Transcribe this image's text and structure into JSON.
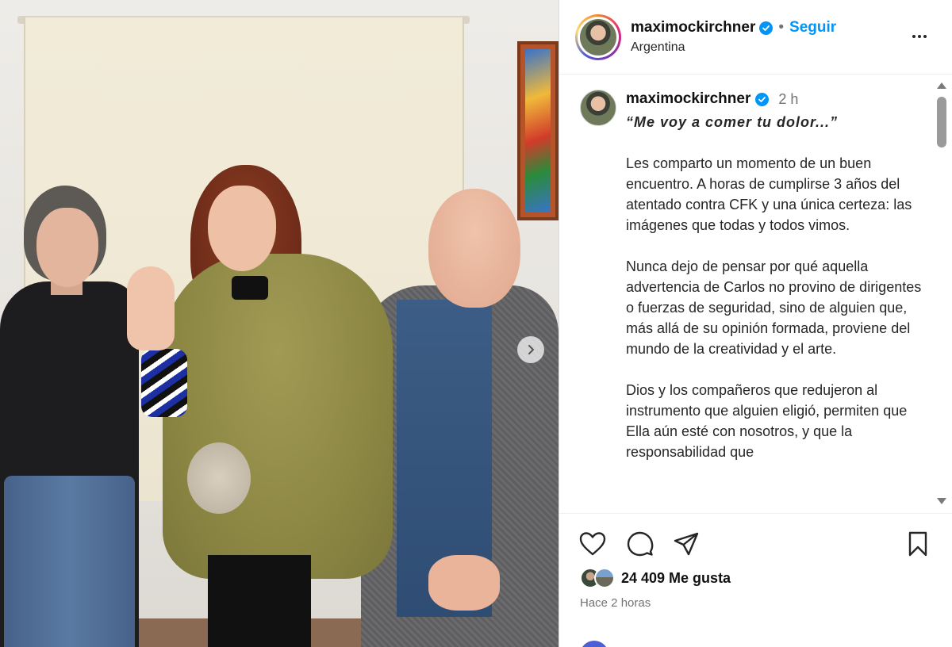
{
  "post": {
    "username": "maximockirchner",
    "follow_label": "Seguir",
    "separator": "•",
    "location": "Argentina",
    "options_icon": "more-horizontal-icon"
  },
  "caption": {
    "username": "maximockirchner",
    "time": "2 h",
    "quote": "“Me voy a comer tu dolor...”",
    "paragraphs": [
      "Les comparto un momento de un buen encuentro. A horas de cumplirse 3 años del atentado contra CFK y una única certeza: las imágenes que todas y todos vimos.",
      "Nunca dejo de pensar por qué aquella advertencia de Carlos no provino de dirigentes o fuerzas de seguridad, sino de alguien que, más allá de su opinión formada, proviene del mundo de la creatividad y el arte.",
      "Dios y los compañeros que redujeron al instrumento que alguien eligió, permiten que Ella aún esté con nosotros, y que la responsabilidad que"
    ]
  },
  "actions": {
    "icons": [
      "heart-icon",
      "comment-icon",
      "share-icon",
      "bookmark-icon"
    ],
    "likes": "24 409 Me gusta",
    "posted_ago": "Hace 2 horas"
  },
  "colors": {
    "accent": "#0095f6",
    "text": "#262626",
    "muted": "#737373"
  }
}
